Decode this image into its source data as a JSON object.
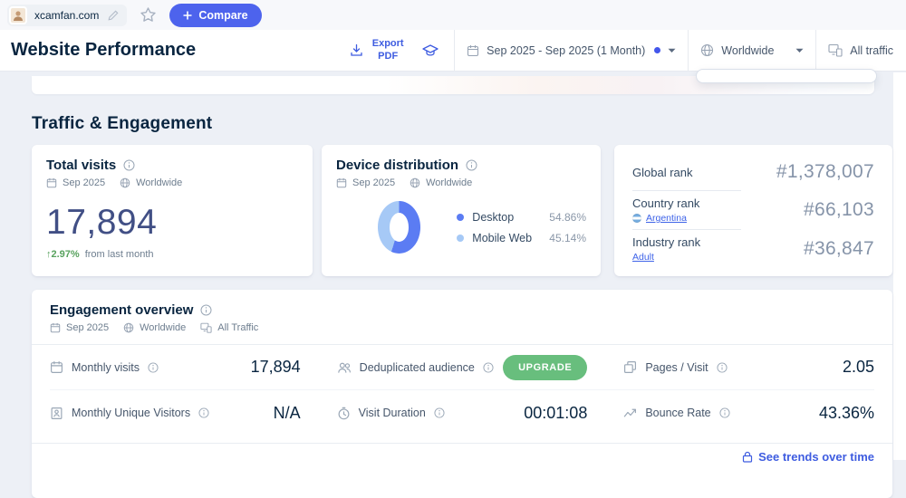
{
  "topbar": {
    "domain": "xcamfan.com",
    "compare_label": "Compare"
  },
  "header": {
    "title": "Website Performance",
    "export_label": "Export PDF",
    "date_range": "Sep 2025 - Sep 2025 (1 Month)",
    "region": "Worldwide",
    "traffic_filter": "All traffic"
  },
  "section_title": "Traffic & Engagement",
  "total_visits": {
    "title": "Total visits",
    "period": "Sep 2025",
    "region": "Worldwide",
    "value": "17,894",
    "change": "↑2.97%",
    "change_note": "from last month"
  },
  "device_distribution": {
    "title": "Device distribution",
    "period": "Sep 2025",
    "region": "Worldwide",
    "legend": [
      {
        "label": "Desktop",
        "value": "54.86%"
      },
      {
        "label": "Mobile Web",
        "value": "45.14%"
      }
    ]
  },
  "chart_data": {
    "type": "pie",
    "title": "Device distribution",
    "categories": [
      "Desktop",
      "Mobile Web"
    ],
    "values": [
      54.86,
      45.14
    ],
    "colors": [
      "#5b7cf3",
      "#a6c9f6"
    ],
    "donut": true,
    "legend_position": "right"
  },
  "ranks": {
    "global": {
      "label": "Global rank",
      "value": "#1,378,007"
    },
    "country": {
      "label": "Country rank",
      "link": "Argentina",
      "value": "#66,103"
    },
    "industry": {
      "label": "Industry rank",
      "link": "Adult",
      "value": "#36,847"
    }
  },
  "engagement": {
    "title": "Engagement overview",
    "period": "Sep 2025",
    "region": "Worldwide",
    "traffic": "All Traffic",
    "metrics": [
      {
        "label": "Monthly visits",
        "value": "17,894"
      },
      {
        "label": "Deduplicated audience",
        "value": "UPGRADE"
      },
      {
        "label": "Pages / Visit",
        "value": "2.05"
      },
      {
        "label": "Monthly Unique Visitors",
        "value": "N/A"
      },
      {
        "label": "Visit Duration",
        "value": "00:01:08"
      },
      {
        "label": "Bounce Rate",
        "value": "43.36%"
      }
    ],
    "footer_link": "See trends over time"
  },
  "colors": {
    "accent_blue": "#3e5ce0",
    "button_blue": "#4d63ed",
    "upgrade_green": "#68be7d",
    "change_green": "#58a25e",
    "big_number": "#414f85",
    "rank_value": "#8694a9"
  }
}
